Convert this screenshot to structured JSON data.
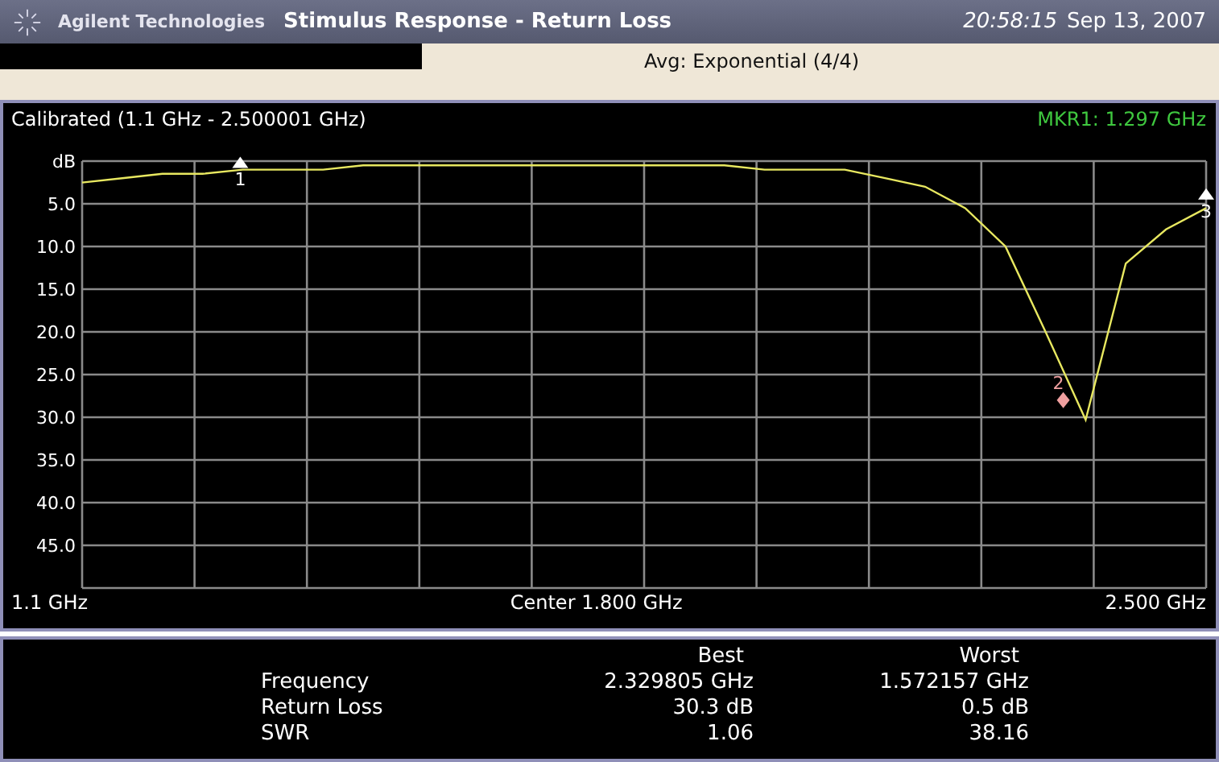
{
  "header": {
    "brand": "Agilent Technologies",
    "title": "Stimulus Response - Return Loss",
    "time": "20:58:15",
    "date": "Sep 13, 2007"
  },
  "status": {
    "averaging": "Avg: Exponential (4/4)"
  },
  "plot": {
    "calibration": "Calibrated (1.1 GHz - 2.500001 GHz)",
    "marker_readout": "MKR1: 1.297 GHz",
    "chart_data": {
      "type": "line",
      "categories": [
        null,
        null,
        null,
        null,
        null,
        null,
        null,
        null,
        null,
        null,
        null,
        null,
        null,
        null,
        null,
        null,
        null,
        null,
        null,
        null,
        null,
        null,
        null,
        null,
        null,
        null,
        null,
        null,
        null
      ],
      "series": [
        {
          "color": "#e8e860",
          "values": [
            2.5,
            2.0,
            1.5,
            1.5,
            1.0,
            1.0,
            1.0,
            0.5,
            0.5,
            0.5,
            0.5,
            0.5,
            0.5,
            0.5,
            0.5,
            0.5,
            0.5,
            1.0,
            1.0,
            1.0,
            2.0,
            3.0,
            5.5,
            10.0,
            20.0,
            30.3,
            12.0,
            8.0,
            5.5
          ]
        }
      ],
      "ylim": [
        50,
        0
      ],
      "grid": true,
      "yticks": [
        {
          "value": 0,
          "label": "dB"
        },
        {
          "value": 5,
          "label": "5.0"
        },
        {
          "value": 10,
          "label": "10.0"
        },
        {
          "value": 15,
          "label": "15.0"
        },
        {
          "value": 20,
          "label": "20.0"
        },
        {
          "value": 25,
          "label": "25.0"
        },
        {
          "value": 30,
          "label": "30.0"
        },
        {
          "value": 35,
          "label": "35.0"
        },
        {
          "value": 40,
          "label": "40.0"
        },
        {
          "value": 45,
          "label": "45.0"
        }
      ]
    },
    "markers": [
      {
        "kind": "triangle",
        "label": "1"
      },
      {
        "kind": "diamond",
        "label": "2"
      },
      {
        "kind": "triangle",
        "label": "3"
      }
    ],
    "frequency_labels": [
      "1.1 GHz",
      "Center 1.800 GHz",
      "2.500 GHz"
    ]
  },
  "results": {
    "columns": [
      "Best",
      "Worst"
    ],
    "rows": [
      {
        "label": "Frequency",
        "best": "2.329805 GHz",
        "worst": "1.572157 GHz"
      },
      {
        "label": "Return Loss",
        "best": "30.3 dB",
        "worst": "0.5 dB"
      },
      {
        "label": "SWR",
        "best": "1.06",
        "worst": "38.16"
      }
    ]
  }
}
